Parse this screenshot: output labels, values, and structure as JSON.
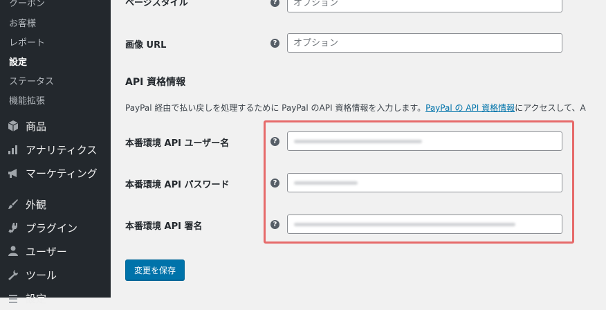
{
  "sidebar": {
    "submenu": [
      {
        "label": "クーポン",
        "current": false
      },
      {
        "label": "お客様",
        "current": false
      },
      {
        "label": "レポート",
        "current": false
      },
      {
        "label": "設定",
        "current": true
      },
      {
        "label": "ステータス",
        "current": false
      },
      {
        "label": "機能拡張",
        "current": false
      }
    ],
    "menu": [
      {
        "label": "商品",
        "icon": "box-icon"
      },
      {
        "label": "アナリティクス",
        "icon": "bar-chart-icon"
      },
      {
        "label": "マーケティング",
        "icon": "megaphone-icon"
      },
      {
        "label": "外観",
        "icon": "paintbrush-icon"
      },
      {
        "label": "プラグイン",
        "icon": "plugin-icon"
      },
      {
        "label": "ユーザー",
        "icon": "user-icon"
      },
      {
        "label": "ツール",
        "icon": "wrench-icon"
      },
      {
        "label": "設定",
        "icon": "settings-icon"
      }
    ]
  },
  "form": {
    "page_style": {
      "label": "ページスタイル",
      "placeholder": "オプション"
    },
    "image_url": {
      "label": "画像 URL",
      "placeholder": "オプション"
    },
    "api_section": {
      "title": "API 資格情報",
      "desc_before": "PayPal 経由で払い戻しを処理するために PayPal のAPI 資格情報を入力します。",
      "link_text": "PayPal の API 資格情報",
      "desc_after": "にアクセスして、A"
    },
    "api_username": {
      "label": "本番環境 API ユーザー名"
    },
    "api_password": {
      "label": "本番環境 API パスワード"
    },
    "api_signature": {
      "label": "本番環境 API 署名"
    },
    "help_glyph": "?",
    "save_label": "変更を保存"
  },
  "colors": {
    "sidebar_bg": "#23282d",
    "primary": "#0073aa",
    "highlight": "#e66a6a"
  }
}
